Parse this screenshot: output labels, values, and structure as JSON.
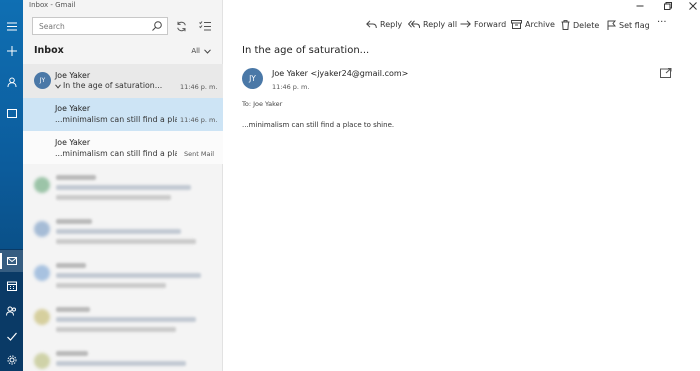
{
  "window": {
    "title": "Inbox - Gmail"
  },
  "search": {
    "placeholder": "Search"
  },
  "list": {
    "header": "Inbox",
    "filter": "All",
    "messages": [
      {
        "sender": "Joe Yaker",
        "initials": "JY",
        "subject": "In the age of saturation...",
        "time": "11:46 p. m.",
        "state": "conversation-header"
      },
      {
        "sender": "Joe Yaker",
        "preview": "...minimalism can still find a place to shine.",
        "time": "11:46 p. m.",
        "state": "selected"
      },
      {
        "sender": "Joe Yaker",
        "preview": "...minimalism can still find a place to shine.",
        "folder": "Sent Mail",
        "state": "plain"
      }
    ]
  },
  "toolbar": {
    "reply": "Reply",
    "reply_all": "Reply all",
    "forward": "Forward",
    "archive": "Archive",
    "delete": "Delete",
    "set_flag": "Set flag",
    "more": "···"
  },
  "reader": {
    "subject": "In the age of saturation...",
    "initials": "JY",
    "from": "Joe Yaker <jyaker24@gmail.com>",
    "time": "11:46 p. m.",
    "to": "To: Joe Yaker",
    "body": "...minimalism can still find a place to shine."
  },
  "colors": {
    "accent": "#0f6fb3",
    "selected_row": "#cde4f5",
    "avatar": "#4a78a7"
  },
  "icons": [
    "hamburger-icon",
    "compose-icon",
    "person-icon",
    "folder-icon",
    "mail-icon",
    "calendar-icon",
    "people-icon",
    "todo-icon",
    "settings-icon",
    "search-icon",
    "sync-icon",
    "select-icon",
    "reply-icon",
    "reply-all-icon",
    "forward-icon",
    "archive-icon",
    "delete-icon",
    "flag-icon",
    "more-icon",
    "popout-icon"
  ]
}
